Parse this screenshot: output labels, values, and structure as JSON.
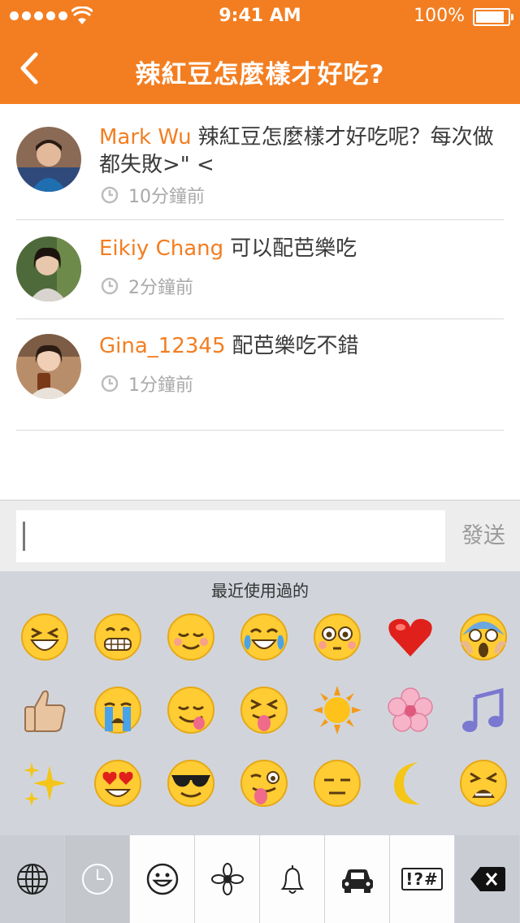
{
  "status_bar": {
    "time": "9:41 AM",
    "battery_text": "100%",
    "battery_level": 1.0
  },
  "header": {
    "title": "辣紅豆怎麼樣才好吃?"
  },
  "comments": [
    {
      "name": "Mark Wu",
      "text": "辣紅豆怎麼樣才好吃呢？每次做都失敗>\" <",
      "time": "10分鐘前"
    },
    {
      "name": "Eikiy Chang",
      "text": "可以配芭樂吃",
      "time": "2分鐘前"
    },
    {
      "name": "Gina_12345",
      "text": "配芭樂吃不錯",
      "time": "1分鐘前"
    }
  ],
  "input": {
    "value": "",
    "placeholder": ""
  },
  "send_label": "發送",
  "keyboard": {
    "section_title": "最近使用過的",
    "emoji_rows": [
      [
        "laughing",
        "grimacing",
        "relaxed",
        "joy",
        "flushed",
        "heart",
        "scream"
      ],
      [
        "thumbsup",
        "sob",
        "yum",
        "stuck-out-tongue-closed-eyes",
        "sunny",
        "cherry-blossom",
        "musical-note"
      ],
      [
        "sparkles",
        "heart-eyes",
        "sunglasses",
        "stuck-out-tongue-winking-eye",
        "expressionless",
        "crescent-moon",
        "tired-face"
      ]
    ],
    "tabs": [
      "globe",
      "recent",
      "smiley",
      "flower",
      "bell",
      "car",
      "!?#",
      "delete"
    ],
    "accent": "#f37e21"
  }
}
